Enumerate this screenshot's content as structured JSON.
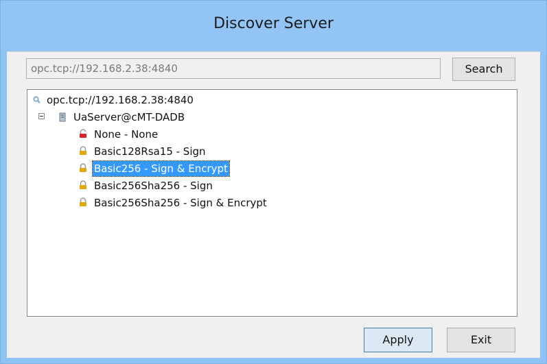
{
  "window": {
    "title": "Discover Server"
  },
  "search": {
    "url_value": "opc.tcp://192.168.2.38:4840",
    "button_label": "Search"
  },
  "tree": {
    "root": {
      "label": "opc.tcp://192.168.2.38:4840",
      "icon": "magnifier-icon"
    },
    "server": {
      "label": "UaServer@cMT-DADB",
      "icon": "server-icon",
      "expanded": true
    },
    "endpoints": [
      {
        "label": "None - None",
        "icon": "unlocked-red-icon",
        "selected": false
      },
      {
        "label": "Basic128Rsa15 - Sign",
        "icon": "lock-icon",
        "selected": false
      },
      {
        "label": "Basic256 - Sign & Encrypt",
        "icon": "lock-icon",
        "selected": true
      },
      {
        "label": "Basic256Sha256 - Sign",
        "icon": "lock-icon",
        "selected": false
      },
      {
        "label": "Basic256Sha256 - Sign & Encrypt",
        "icon": "lock-icon",
        "selected": false
      }
    ]
  },
  "buttons": {
    "apply": "Apply",
    "exit": "Exit"
  },
  "colors": {
    "title_bar": "#92c5f5",
    "selection": "#3399ff",
    "lock": "#e0a800",
    "unlocked": "#d9232a"
  }
}
